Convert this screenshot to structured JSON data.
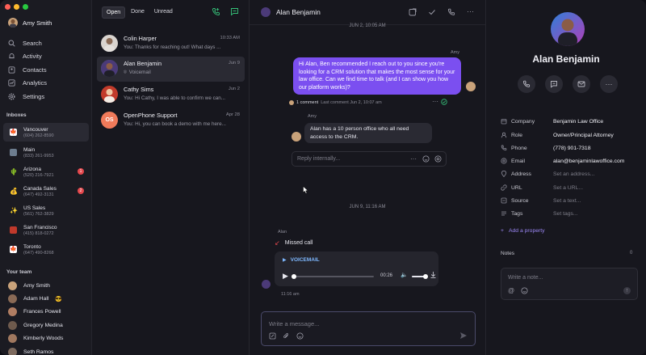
{
  "window": {
    "traffic_colors": [
      "#fe5f57",
      "#febc2e",
      "#28c840"
    ]
  },
  "sidebar": {
    "user_name": "Amy Smith",
    "nav": [
      {
        "label": "Search",
        "icon": "search-icon"
      },
      {
        "label": "Activity",
        "icon": "bell-icon"
      },
      {
        "label": "Contacts",
        "icon": "contacts-icon"
      },
      {
        "label": "Analytics",
        "icon": "chart-icon"
      },
      {
        "label": "Settings",
        "icon": "gear-icon"
      }
    ],
    "inboxes_title": "Inboxes",
    "inboxes": [
      {
        "name": "Vancouver",
        "phone": "(604) 262-8590",
        "flag": "canada-flag-icon",
        "badge": ""
      },
      {
        "name": "Main",
        "phone": "(833) 261-9953",
        "flag": "building-icon",
        "badge": ""
      },
      {
        "name": "Arizona",
        "phone": "(520) 216-7921",
        "flag": "cactus-icon",
        "badge": "1"
      },
      {
        "name": "Canada Sales",
        "phone": "(647) 492-3131",
        "flag": "money-bag-icon",
        "badge": "2"
      },
      {
        "name": "US Sales",
        "phone": "(561) 762-3829",
        "flag": "sparkle-icon",
        "badge": ""
      },
      {
        "name": "San Francisco",
        "phone": "(415) 818-0272",
        "flag": "bridge-icon",
        "badge": ""
      },
      {
        "name": "Toronto",
        "phone": "(647) 490-8268",
        "flag": "canada-flag-icon",
        "badge": ""
      }
    ],
    "team_title": "Your team",
    "team": [
      {
        "name": "Amy Smith",
        "emoji": ""
      },
      {
        "name": "Adam Hall",
        "emoji": "😎"
      },
      {
        "name": "Frances Powell",
        "emoji": ""
      },
      {
        "name": "Gregory Medina",
        "emoji": ""
      },
      {
        "name": "Kimberly Woods",
        "emoji": ""
      },
      {
        "name": "Seth Ramos",
        "emoji": ""
      }
    ]
  },
  "list": {
    "tabs": [
      "Open",
      "Done",
      "Unread"
    ],
    "conversations": [
      {
        "name": "Colin Harper",
        "preview": "You: Thanks for reaching out! What days ...",
        "time": "10:33 AM"
      },
      {
        "name": "Alan Benjamin",
        "preview": "Voicemail",
        "time": "Jun 9"
      },
      {
        "name": "Cathy Sims",
        "preview": "You: Hi Cathy, I was able to confirm we can...",
        "time": "Jun 2"
      },
      {
        "name": "OpenPhone Support",
        "preview": "You: Hi, you can book a demo with me here...",
        "time": "Apr 28"
      }
    ],
    "support_initials": "OS"
  },
  "chat": {
    "header_name": "Alan Benjamin",
    "date1": "JUN 2, 10:05 AM",
    "sender1": "Amy",
    "out_message": "Hi Alan, Ben recommended I reach out to you since you're looking for a CRM solution that makes the most sense for your law office. Can we find time to talk (and I can show you how our platform works)?",
    "comment_count": "1 comment",
    "comment_meta": "Last comment Jun 2, 10:07 am",
    "sender2": "Amy",
    "in_message": "Alan has a 10 person office who all need access to the CRM.",
    "reply_placeholder": "Reply internally...",
    "date2": "JUN 9, 11:16 AM",
    "sender3": "Alan",
    "missed_call": "Missed call",
    "voicemail_label": "VOICEMAIL",
    "audio_time": "00:26",
    "audio_progress": 0.0,
    "volume": 0.8,
    "vm_time": "11:16 am",
    "compose_placeholder": "Write a message..."
  },
  "contact": {
    "name": "Alan Benjamin",
    "fields": [
      {
        "label": "Company",
        "value": "Benjamin Law Office",
        "placeholder": false,
        "icon": "company-icon"
      },
      {
        "label": "Role",
        "value": "Owner/Principal Attorney",
        "placeholder": false,
        "icon": "role-icon"
      },
      {
        "label": "Phone",
        "value": "(778) 901-7318",
        "placeholder": false,
        "icon": "phone-icon"
      },
      {
        "label": "Email",
        "value": "alan@benjaminlawoffice.com",
        "placeholder": false,
        "icon": "email-icon"
      },
      {
        "label": "Address",
        "value": "Set an address...",
        "placeholder": true,
        "icon": "location-icon"
      },
      {
        "label": "URL",
        "value": "Set a URL...",
        "placeholder": true,
        "icon": "link-icon"
      },
      {
        "label": "Source",
        "value": "Set a text...",
        "placeholder": true,
        "icon": "source-icon"
      },
      {
        "label": "Tags",
        "value": "Set tags...",
        "placeholder": true,
        "icon": "tags-icon"
      }
    ],
    "add_property": "Add a property",
    "notes_title": "Notes",
    "notes_count": "0",
    "notes_placeholder": "Write a note..."
  }
}
